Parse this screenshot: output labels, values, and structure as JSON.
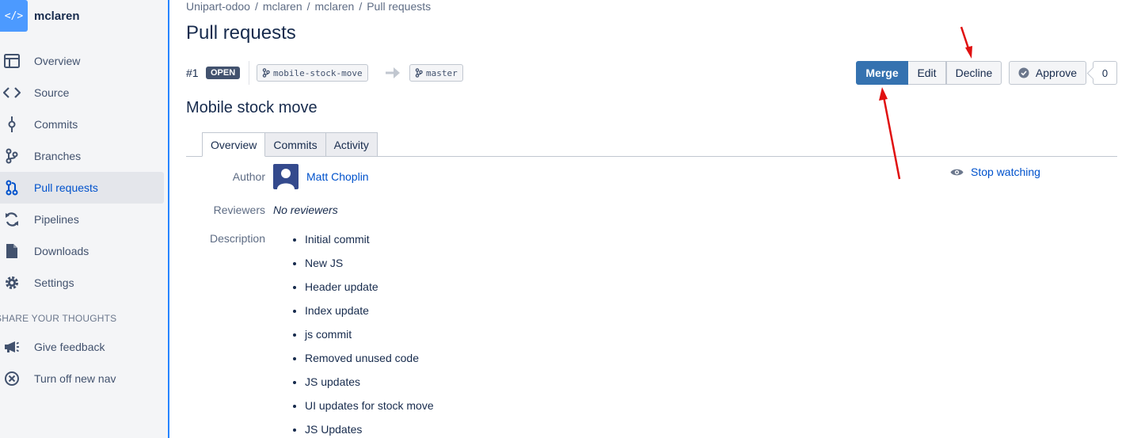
{
  "sidebar": {
    "repo_initials": "</>",
    "repo_name": "mclaren",
    "items": [
      {
        "label": "Overview",
        "icon": "overview-icon"
      },
      {
        "label": "Source",
        "icon": "code-icon"
      },
      {
        "label": "Commits",
        "icon": "commit-icon"
      },
      {
        "label": "Branches",
        "icon": "branch-icon"
      },
      {
        "label": "Pull requests",
        "icon": "pull-request-icon"
      },
      {
        "label": "Pipelines",
        "icon": "pipelines-icon"
      },
      {
        "label": "Downloads",
        "icon": "document-icon"
      },
      {
        "label": "Settings",
        "icon": "gear-icon"
      }
    ],
    "section_label": "SHARE YOUR THOUGHTS",
    "extra_items": [
      {
        "label": "Give feedback",
        "icon": "megaphone-icon"
      },
      {
        "label": "Turn off new nav",
        "icon": "close-circle-icon"
      }
    ],
    "accent_color": "#2684ff",
    "active_color": "#0052cc"
  },
  "breadcrumb": [
    "Unipart-odoo",
    "mclaren",
    "mclaren",
    "Pull requests"
  ],
  "breadcrumb_separator": "/",
  "page_title": "Pull requests",
  "pull_request": {
    "number": "#1",
    "status": "OPEN",
    "source_branch": "mobile-stock-move",
    "target_branch": "master",
    "title": "Mobile stock move",
    "actions": {
      "merge": "Merge",
      "edit": "Edit",
      "decline": "Decline",
      "approve": "Approve",
      "approval_count": "0"
    },
    "tabs": [
      "Overview",
      "Commits",
      "Activity"
    ],
    "fields": {
      "author_label": "Author",
      "author_name": "Matt Choplin",
      "reviewers_label": "Reviewers",
      "reviewers_value": "No reviewers",
      "description_label": "Description"
    },
    "description_items": [
      "Initial commit",
      "New JS",
      "Header update",
      "Index update",
      "js commit",
      "Removed unused code",
      "JS updates",
      "UI updates for stock move",
      "JS Updates"
    ],
    "watch_label": "Stop watching"
  },
  "colors": {
    "merge_button": "#3572b0",
    "link": "#0052cc",
    "annotation_arrow": "#e01010"
  }
}
